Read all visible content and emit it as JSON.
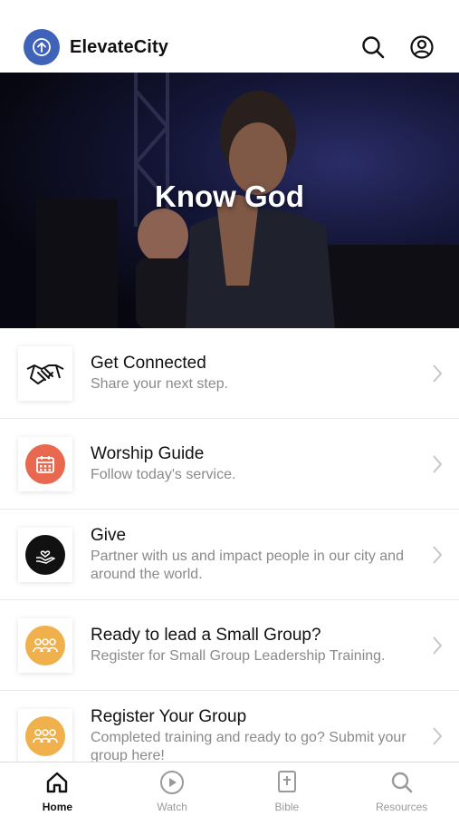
{
  "app": {
    "brand": "ElevateCity"
  },
  "header": {
    "search_icon": "search-icon",
    "profile_icon": "account-icon"
  },
  "hero": {
    "title": "Know God",
    "slides_total": 4,
    "active_slide": 1
  },
  "list": [
    {
      "title": "Get Connected",
      "subtitle": "Share your next step.",
      "icon": "handshake-icon"
    },
    {
      "title": "Worship Guide",
      "subtitle": "Follow today's service.",
      "icon": "calendar-icon",
      "color": "#e8694f"
    },
    {
      "title": "Give",
      "subtitle": "Partner with us and impact people in our city and around the world.",
      "icon": "giving-hand-icon",
      "color": "#111111"
    },
    {
      "title": "Ready to lead a Small Group?",
      "subtitle": "Register for Small Group Leadership Training.",
      "icon": "group-icon",
      "color": "#f0b14c"
    },
    {
      "title": "Register Your Group",
      "subtitle": "Completed training and ready to go? Submit your group here!",
      "icon": "group-icon",
      "color": "#f0b14c"
    }
  ],
  "tabs": [
    {
      "label": "Home",
      "icon": "home-icon",
      "active": true
    },
    {
      "label": "Watch",
      "icon": "play-icon"
    },
    {
      "label": "Bible",
      "icon": "bible-icon"
    },
    {
      "label": "Resources",
      "icon": "search-icon"
    }
  ],
  "colors": {
    "brand_blue": "#3e63b8",
    "accent_orange": "#e8694f",
    "accent_gold": "#f0b14c"
  }
}
